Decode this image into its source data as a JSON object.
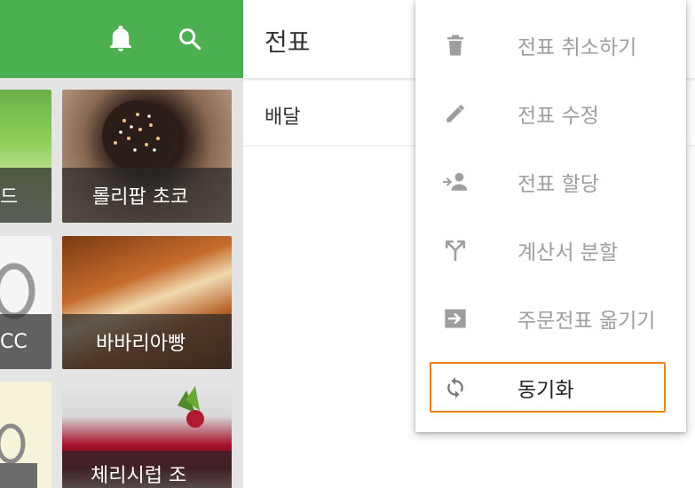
{
  "left": {
    "tiles": [
      {
        "label": "드"
      },
      {
        "label": "롤리팝 초코"
      },
      {
        "label": "CC"
      },
      {
        "label": "바바리아빵"
      },
      {
        "label": ""
      },
      {
        "label": "체리시럽 조"
      }
    ]
  },
  "sheet": {
    "title": "전표",
    "row_label": "배달"
  },
  "menu": {
    "items": [
      {
        "label": "전표 취소하기",
        "icon": "trash-icon"
      },
      {
        "label": "전표 수정",
        "icon": "pencil-icon"
      },
      {
        "label": "전표 할당",
        "icon": "assign-person-icon"
      },
      {
        "label": "계산서 분할",
        "icon": "split-icon"
      },
      {
        "label": "주문전표 옮기기",
        "icon": "move-ticket-icon"
      },
      {
        "label": "동기화",
        "icon": "sync-icon"
      }
    ],
    "focused_index": 5
  },
  "colors": {
    "toolbar": "#4caf50",
    "focus": "#f0801a",
    "menu_icon": "#9e9e9e"
  }
}
